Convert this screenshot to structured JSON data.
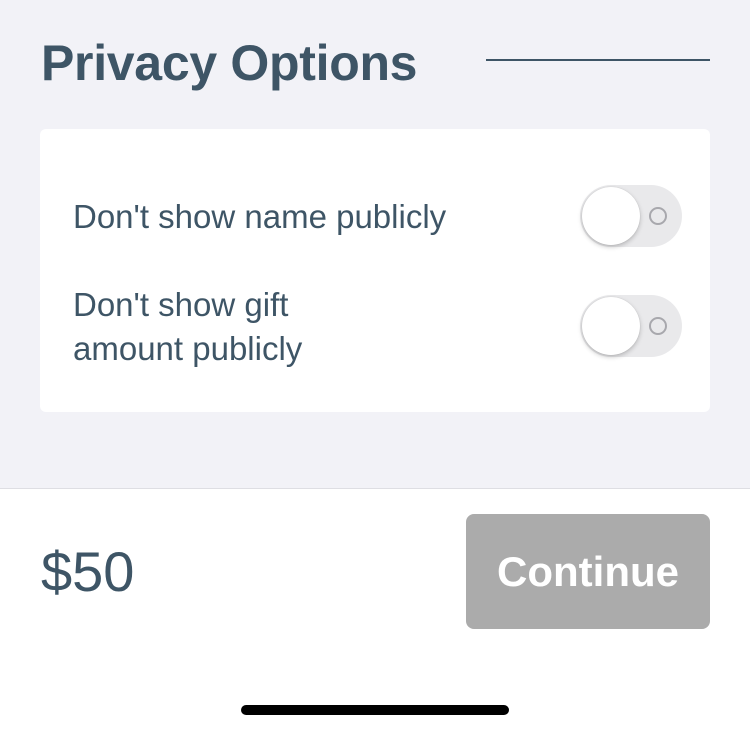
{
  "header": {
    "title": "Privacy Options"
  },
  "options": [
    {
      "label": "Don't show name publicly",
      "enabled": false
    },
    {
      "label": "Don't show gift amount publicly",
      "enabled": false
    }
  ],
  "footer": {
    "amount": "$50",
    "continue_label": "Continue",
    "continue_enabled": false
  },
  "colors": {
    "text": "#3e5566",
    "page_background": "#f2f2f7",
    "button_disabled": "#ababab",
    "toggle_off_track": "#e9e9eb"
  }
}
